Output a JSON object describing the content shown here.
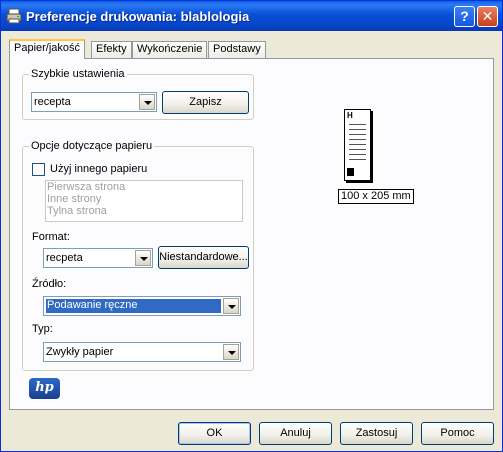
{
  "window": {
    "title": "Preferencje drukowania: blablologia",
    "help_glyph": "?",
    "close_glyph": "✕"
  },
  "tabs": [
    {
      "label": "Papier/jakość",
      "active": true
    },
    {
      "label": "Efekty",
      "active": false
    },
    {
      "label": "Wykończenie",
      "active": false
    },
    {
      "label": "Podstawy",
      "active": false
    }
  ],
  "quick_settings": {
    "group_label": "Szybkie ustawienia",
    "selected": "recepta",
    "save_label": "Zapisz"
  },
  "paper_options": {
    "group_label": "Opcje dotyczące papieru",
    "use_other_paper_label": "Użyj innego papieru",
    "use_other_paper_checked": false,
    "pages": [
      "Pierwsza strona",
      "Inne strony",
      "Tylna strona"
    ],
    "format_label": "Format:",
    "format_value": "recpeta",
    "custom_label": "Niestandardowe...",
    "source_label": "Źródło:",
    "source_value": "Podawanie ręczne",
    "type_label": "Typ:",
    "type_value": "Zwykły papier"
  },
  "preview": {
    "page_letter": "H",
    "size_label": "100 x 205 mm"
  },
  "logo": {
    "text": "hp"
  },
  "footer": {
    "ok_label": "OK",
    "cancel_label": "Anuluj",
    "apply_label": "Zastosuj",
    "help_label": "Pomoc"
  },
  "colors": {
    "title_bar": "#0a4fd6",
    "selection": "#316ac5",
    "tab_highlight": "#ffc83c"
  }
}
